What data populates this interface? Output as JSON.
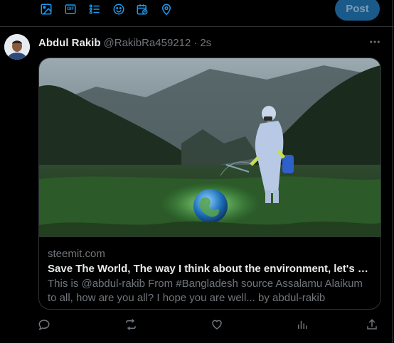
{
  "composer": {
    "tools": [
      {
        "icon": "image-icon"
      },
      {
        "icon": "gif-icon",
        "label": "GIF"
      },
      {
        "icon": "poll-icon"
      },
      {
        "icon": "emoji-icon"
      },
      {
        "icon": "schedule-icon"
      },
      {
        "icon": "location-icon"
      }
    ],
    "post_label": "Post"
  },
  "tweet": {
    "author_name": "Abdul Rakib",
    "handle": "@RakibRa459212",
    "separator": "·",
    "time": "2s",
    "card": {
      "domain": "steemit.com",
      "title": "Save The World, The way I think about the environment, let's be dedic...",
      "description": "This is @abdul-rakib From #Bangladesh source Assalamu Alaikum to all, how are you all? I hope you are well... by abdul-rakib"
    },
    "actions": [
      "reply-icon",
      "repost-icon",
      "like-icon",
      "views-icon",
      "share-icon"
    ]
  },
  "colors": {
    "background": "#000000",
    "accent": "#1d9bf0",
    "muted_text": "#71767b",
    "border": "#2f3336",
    "post_button_disabled": "#1a5a8a"
  }
}
